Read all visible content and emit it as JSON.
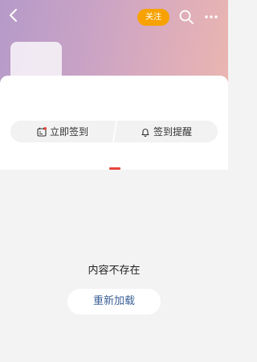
{
  "header": {
    "follow_label": "关注",
    "icons": [
      "back-arrow-icon",
      "search-icon",
      "more-icon"
    ],
    "follow_color": "#f7a200"
  },
  "sign": {
    "checkin_label": "立即签到",
    "reminder_label": "签到提醒"
  },
  "content": {
    "empty_message": "内容不存在",
    "reload_label": "重新加载",
    "accent_color": "#e8463c",
    "link_color": "#3a5f95"
  }
}
